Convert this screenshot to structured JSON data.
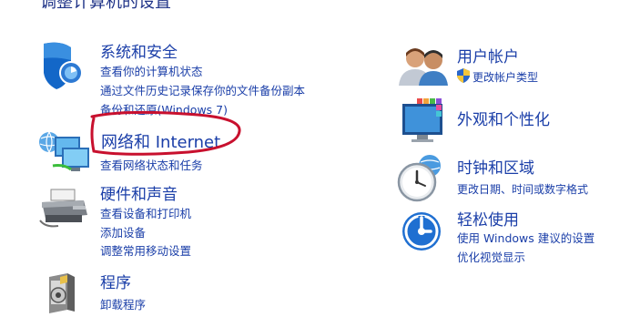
{
  "page": {
    "title": "调整计算机的设置"
  },
  "left": [
    {
      "title": "系统和安全",
      "links": [
        "查看你的计算机状态",
        "通过文件历史记录保存你的文件备份副本",
        "备份和还原(Windows 7)"
      ]
    },
    {
      "title": "网络和 Internet",
      "links": [
        "查看网络状态和任务"
      ]
    },
    {
      "title": "硬件和声音",
      "links": [
        "查看设备和打印机",
        "添加设备",
        "调整常用移动设置"
      ]
    },
    {
      "title": "程序",
      "links": [
        "卸载程序"
      ]
    }
  ],
  "right": [
    {
      "title": "用户帐户",
      "links": [
        "更改帐户类型"
      ]
    },
    {
      "title": "外观和个性化",
      "links": []
    },
    {
      "title": "时钟和区域",
      "links": [
        "更改日期、时间或数字格式"
      ]
    },
    {
      "title": "轻松使用",
      "links": [
        "使用 Windows 建议的设置",
        "优化视觉显示"
      ]
    }
  ],
  "colors": {
    "link": "#1a3ea8",
    "annotation": "#c8102e"
  },
  "icons": [
    "shield-icon",
    "network-icon",
    "printer-icon",
    "programs-icon",
    "users-icon",
    "uac-shield-icon",
    "display-icon",
    "clock-icon",
    "accessibility-icon"
  ]
}
